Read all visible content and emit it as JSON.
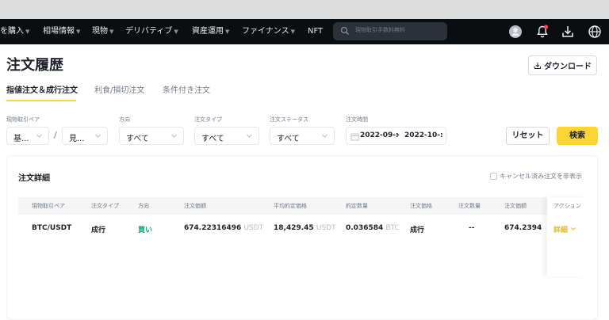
{
  "nav": {
    "items": [
      {
        "label": "を購入",
        "has_caret": true
      },
      {
        "label": "相場情報",
        "has_caret": true
      },
      {
        "label": "現物",
        "has_caret": true
      },
      {
        "label": "デリバティブ",
        "has_caret": true
      },
      {
        "label": "資産運用",
        "has_caret": true
      },
      {
        "label": "ファイナンス",
        "has_caret": true
      },
      {
        "label": "NFT",
        "has_caret": false
      }
    ],
    "search_placeholder": "現物取引手数料無料",
    "icons": [
      "avatar-icon",
      "notification-bell-icon",
      "download-icon",
      "globe-icon"
    ],
    "notification_dot_color": "#f6465d"
  },
  "page": {
    "title": "注文履歴",
    "download_label": "ダウンロード"
  },
  "tabs": [
    {
      "label": "指値注文＆成行注文",
      "active": true
    },
    {
      "label": "利食/損切注文",
      "active": false
    },
    {
      "label": "条件付き注文",
      "active": false
    }
  ],
  "filters": {
    "pair_label": "現物取引ペア",
    "pair_base": "基...",
    "pair_quote": "見...",
    "pair_separator": "/",
    "side_label": "方向",
    "side_value": "すべて",
    "type_label": "注文タイプ",
    "type_value": "すべて",
    "status_label": "注文ステータス",
    "status_value": "すべて",
    "time_label": "注文時間",
    "date_from": "2022-09-:",
    "date_separator": "-",
    "date_to": "2022-10-:",
    "reset_label": "リセット",
    "search_label": "検索"
  },
  "details": {
    "title": "注文詳細",
    "hide_cancelled_label": "キャンセル済み注文を非表示",
    "columns": [
      "現物取引ペア",
      "注文タイプ",
      "方向",
      "注文価額",
      "平均約定価格",
      "約定数量",
      "注文価格",
      "注文数量",
      "注文価額",
      "アクション"
    ],
    "rows": [
      {
        "pair": "BTC/USDT",
        "type": "成行",
        "side": "買い",
        "order_value": "674.22316496",
        "order_value_unit": "USDT",
        "avg_price": "18,429.45",
        "avg_price_unit": "USDT",
        "filled": "0.036584",
        "filled_unit": "BTC",
        "order_price": "成行",
        "order_qty": "--",
        "order_amount": "674.2394",
        "action": "詳細"
      }
    ]
  },
  "colors": {
    "accent": "#fcd535",
    "buy": "#03a66d",
    "link": "#f0b90b",
    "navbar": "#0b0e11"
  }
}
